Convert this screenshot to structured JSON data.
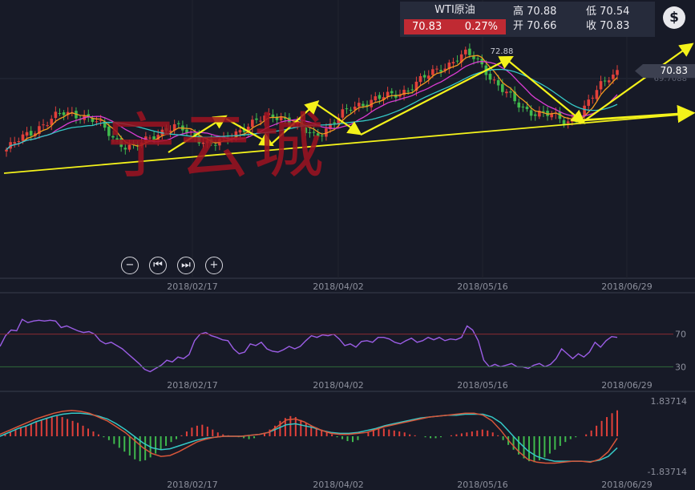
{
  "quote": {
    "name": "WTI原油",
    "price": "70.83",
    "change": "0.27%",
    "high_label": "高",
    "high": "70.88",
    "low_label": "低",
    "low": "70.54",
    "open_label": "开",
    "open": "70.66",
    "close_label": "收",
    "close": "70.83"
  },
  "colors": {
    "background": "#171a27",
    "up": "#e2403a",
    "down": "#3fb94d",
    "trend": "#f4f21a",
    "ma_orange": "#f19a1f",
    "ma_magenta": "#d93bd2",
    "ma_cyan": "#35c8c6",
    "rsi": "#9b5de5"
  },
  "watermark": "宁云城",
  "last_price_tag": "70.83",
  "secondary_price_label": "69.7088",
  "peak_label": "72.88",
  "controls": [
    {
      "name": "zoom-out-button",
      "glyph": "−"
    },
    {
      "name": "prev-button",
      "glyph": "⏮"
    },
    {
      "name": "next-button",
      "glyph": "⏭"
    },
    {
      "name": "zoom-in-button",
      "glyph": "+"
    }
  ],
  "chart_data": {
    "type": "candlestick",
    "x_ticks": [
      "2018/02/17",
      "2018/04/02",
      "2018/05/16",
      "2018/06/29"
    ],
    "price_series": [
      62.2,
      62.9,
      63.6,
      64.2,
      64.8,
      65.3,
      65.9,
      66.3,
      66.2,
      66.0,
      65.6,
      65.1,
      64.3,
      63.4,
      62.7,
      62.4,
      62.8,
      63.4,
      64.0,
      64.5,
      64.7,
      64.4,
      63.9,
      63.5,
      63.0,
      62.8,
      63.2,
      63.8,
      64.5,
      65.0,
      65.4,
      65.7,
      66.0,
      65.8,
      65.3,
      64.7,
      64.0,
      63.8,
      64.4,
      65.2,
      66.0,
      66.7,
      67.2,
      67.5,
      67.8,
      68.0,
      68.2,
      68.5,
      69.0,
      69.6,
      70.2,
      70.8,
      71.4,
      71.8,
      72.4,
      72.8,
      72.4,
      71.5,
      70.1,
      69.0,
      68.2,
      67.4,
      66.8,
      66.3,
      66.1,
      66.0,
      65.8,
      65.4,
      65.7,
      66.5,
      68.0,
      69.5,
      70.5,
      70.83
    ],
    "rsi": {
      "levels": [
        70,
        30
      ],
      "values": [
        55,
        68,
        75,
        74,
        88,
        84,
        86,
        87,
        86,
        87,
        86,
        78,
        80,
        77,
        74,
        72,
        73,
        70,
        62,
        58,
        60,
        56,
        52,
        46,
        40,
        34,
        27,
        24,
        28,
        32,
        38,
        36,
        42,
        40,
        45,
        62,
        70,
        72,
        68,
        66,
        63,
        62,
        52,
        46,
        48,
        58,
        56,
        60,
        52,
        49,
        48,
        51,
        55,
        52,
        55,
        62,
        68,
        66,
        69,
        68,
        70,
        64,
        56,
        58,
        54,
        61,
        62,
        60,
        66,
        66,
        64,
        60,
        58,
        62,
        65,
        60,
        62,
        66,
        63,
        66,
        62,
        64,
        63,
        66,
        80,
        75,
        62,
        38,
        30,
        33,
        30,
        32,
        34,
        30,
        30,
        28,
        32,
        34,
        30,
        33,
        40,
        52,
        46,
        40,
        46,
        42,
        48,
        60,
        54,
        62,
        67,
        66
      ]
    },
    "macd": {
      "y_ticks": [
        "1.83714",
        "-1.83714"
      ],
      "ylim": [
        -1.83714,
        1.83714
      ],
      "histogram": [
        0.05,
        0.15,
        0.25,
        0.35,
        0.45,
        0.55,
        0.65,
        0.75,
        0.85,
        0.95,
        1.0,
        1.05,
        1.0,
        0.9,
        0.8,
        0.7,
        0.55,
        0.4,
        0.25,
        0.1,
        -0.05,
        -0.2,
        -0.4,
        -0.6,
        -0.8,
        -1.0,
        -1.2,
        -1.3,
        -1.25,
        -1.1,
        -0.9,
        -0.7,
        -0.5,
        -0.3,
        -0.15,
        0.05,
        0.25,
        0.45,
        0.55,
        0.6,
        0.5,
        0.35,
        0.2,
        0.1,
        0.05,
        0.0,
        -0.05,
        -0.1,
        -0.15,
        -0.1,
        0.0,
        0.15,
        0.35,
        0.55,
        0.8,
        0.95,
        1.05,
        1.0,
        0.85,
        0.7,
        0.55,
        0.45,
        0.35,
        0.25,
        0.1,
        -0.05,
        -0.15,
        -0.25,
        -0.3,
        -0.2,
        0.0,
        0.2,
        0.35,
        0.45,
        0.4,
        0.35,
        0.3,
        0.25,
        0.2,
        0.1,
        0.05,
        0.0,
        -0.05,
        -0.1,
        -0.1,
        -0.05,
        0.0,
        0.05,
        0.1,
        0.15,
        0.2,
        0.25,
        0.3,
        0.35,
        0.3,
        0.2,
        0.05,
        -0.2,
        -0.45,
        -0.7,
        -0.95,
        -1.15,
        -1.3,
        -1.35,
        -1.25,
        -1.1,
        -0.9,
        -0.7,
        -0.5,
        -0.3,
        -0.15,
        -0.05,
        0.0,
        0.1,
        0.3,
        0.55,
        0.8,
        1.0,
        1.2,
        1.35
      ],
      "dif": [
        0.1,
        0.3,
        0.5,
        0.7,
        0.9,
        1.05,
        1.2,
        1.3,
        1.35,
        1.3,
        1.2,
        1.0,
        0.8,
        0.5,
        0.2,
        -0.2,
        -0.6,
        -0.9,
        -1.05,
        -1.0,
        -0.8,
        -0.55,
        -0.3,
        -0.15,
        -0.05,
        0.0,
        0.0,
        0.0,
        0.05,
        0.1,
        0.2,
        0.5,
        0.85,
        0.9,
        0.75,
        0.5,
        0.3,
        0.15,
        0.1,
        0.1,
        0.15,
        0.2,
        0.35,
        0.5,
        0.6,
        0.7,
        0.8,
        0.9,
        1.0,
        1.05,
        1.1,
        1.15,
        1.2,
        1.2,
        1.1,
        0.8,
        0.3,
        -0.3,
        -0.8,
        -1.2,
        -1.35,
        -1.4,
        -1.4,
        -1.35,
        -1.3,
        -1.3,
        -1.35,
        -1.2,
        -0.8,
        -0.1
      ],
      "dea": [
        0.0,
        0.2,
        0.4,
        0.55,
        0.75,
        0.9,
        1.05,
        1.15,
        1.2,
        1.2,
        1.15,
        1.05,
        0.9,
        0.65,
        0.35,
        0.0,
        -0.35,
        -0.6,
        -0.7,
        -0.65,
        -0.5,
        -0.35,
        -0.2,
        -0.1,
        -0.05,
        0.0,
        0.0,
        0.0,
        0.05,
        0.1,
        0.2,
        0.4,
        0.6,
        0.65,
        0.55,
        0.45,
        0.3,
        0.2,
        0.15,
        0.15,
        0.2,
        0.3,
        0.4,
        0.55,
        0.65,
        0.75,
        0.85,
        0.95,
        1.0,
        1.05,
        1.1,
        1.1,
        1.15,
        1.15,
        1.15,
        1.0,
        0.7,
        0.2,
        -0.3,
        -0.75,
        -1.05,
        -1.2,
        -1.3,
        -1.3,
        -1.3,
        -1.3,
        -1.32,
        -1.25,
        -1.05,
        -0.6
      ]
    }
  }
}
